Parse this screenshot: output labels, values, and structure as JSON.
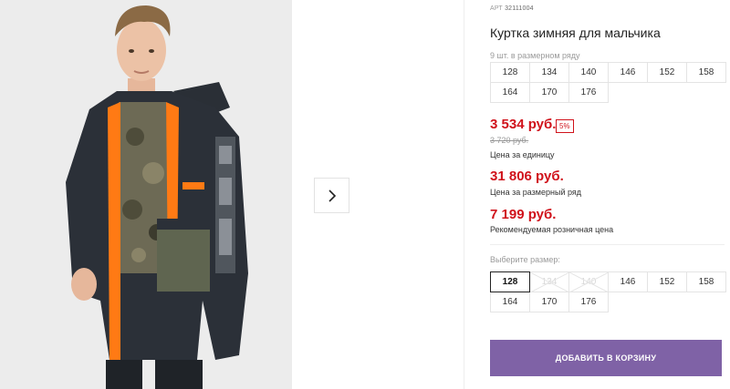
{
  "product": {
    "article_label": "АРТ",
    "article_number": "32111004",
    "title": "Куртка зимняя для мальчика",
    "row_count_text": "9 шт. в размерном ряду"
  },
  "size_row": [
    "128",
    "134",
    "140",
    "146",
    "152",
    "158",
    "164",
    "170",
    "176"
  ],
  "prices": {
    "unit_price": "3 534 руб.",
    "discount": "5%",
    "old_price": "3 720 руб.",
    "unit_caption": "Цена за единицу",
    "row_price": "31 806 руб.",
    "row_caption": "Цена за размерный ряд",
    "retail_price": "7 199 руб.",
    "retail_caption": "Рекомендуемая розничная цена"
  },
  "size_picker": {
    "label": "Выберите размер:",
    "options": [
      {
        "size": "128",
        "state": "selected"
      },
      {
        "size": "134",
        "state": "disabled"
      },
      {
        "size": "140",
        "state": "disabled"
      },
      {
        "size": "146",
        "state": "available"
      },
      {
        "size": "152",
        "state": "available"
      },
      {
        "size": "158",
        "state": "available"
      },
      {
        "size": "164",
        "state": "available"
      },
      {
        "size": "170",
        "state": "available"
      },
      {
        "size": "176",
        "state": "available"
      }
    ]
  },
  "cart_button_label": "ДОБАВИТЬ В КОРЗИНУ",
  "colors": {
    "price_red": "#d0121b",
    "button_purple": "#7f62a6"
  },
  "icons": {
    "gallery_next": "chevron-right-icon",
    "size_disabled": "cross-out-mark"
  }
}
